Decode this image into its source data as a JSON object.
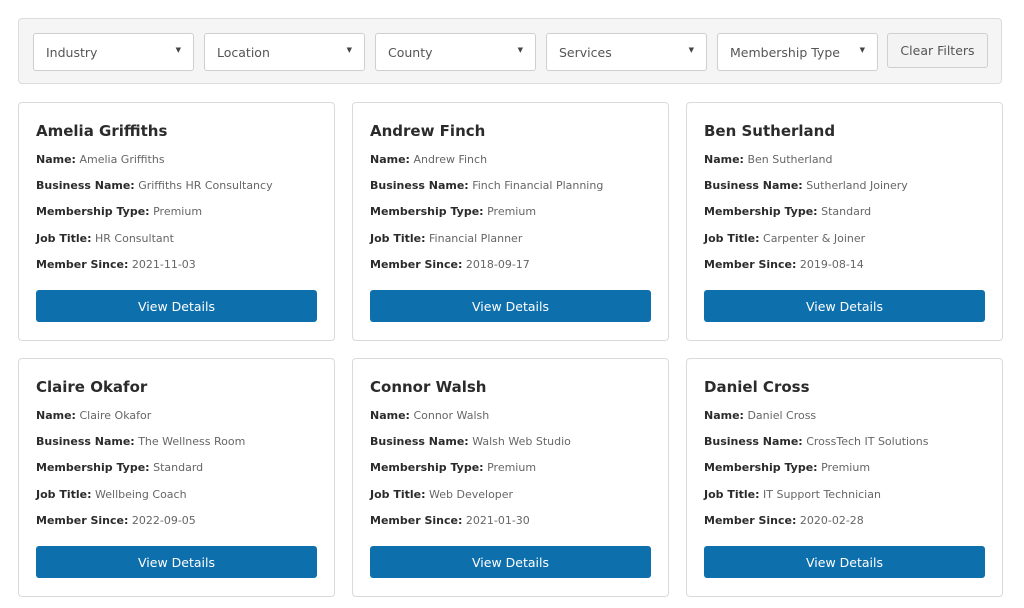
{
  "filters": [
    {
      "label": "Industry"
    },
    {
      "label": "Location"
    },
    {
      "label": "County"
    },
    {
      "label": "Services"
    },
    {
      "label": "Membership Type"
    }
  ],
  "caret_glyph": "▼",
  "clear_label": "Clear Filters",
  "field_labels": {
    "name": "Name:",
    "business": "Business Name:",
    "membership": "Membership Type:",
    "job": "Job Title:",
    "since": "Member Since:"
  },
  "view_label": "View Details",
  "theme": {
    "button_color": "#0e6fad",
    "panel_bg": "#f5f5f5"
  },
  "members": [
    {
      "title": "Amelia Griffiths",
      "name": "Amelia Griffiths",
      "business": "Griffiths HR Consultancy",
      "membership": "Premium",
      "job": "HR Consultant",
      "since": "2021-11-03"
    },
    {
      "title": "Andrew Finch",
      "name": "Andrew Finch",
      "business": "Finch Financial Planning",
      "membership": "Premium",
      "job": "Financial Planner",
      "since": "2018-09-17"
    },
    {
      "title": "Ben Sutherland",
      "name": "Ben Sutherland",
      "business": "Sutherland Joinery",
      "membership": "Standard",
      "job": "Carpenter & Joiner",
      "since": "2019-08-14"
    },
    {
      "title": "Claire Okafor",
      "name": "Claire Okafor",
      "business": "The Wellness Room",
      "membership": "Standard",
      "job": "Wellbeing Coach",
      "since": "2022-09-05"
    },
    {
      "title": "Connor Walsh",
      "name": "Connor Walsh",
      "business": "Walsh Web Studio",
      "membership": "Premium",
      "job": "Web Developer",
      "since": "2021-01-30"
    },
    {
      "title": "Daniel Cross",
      "name": "Daniel Cross",
      "business": "CrossTech IT Solutions",
      "membership": "Premium",
      "job": "IT Support Technician",
      "since": "2020-02-28"
    }
  ]
}
